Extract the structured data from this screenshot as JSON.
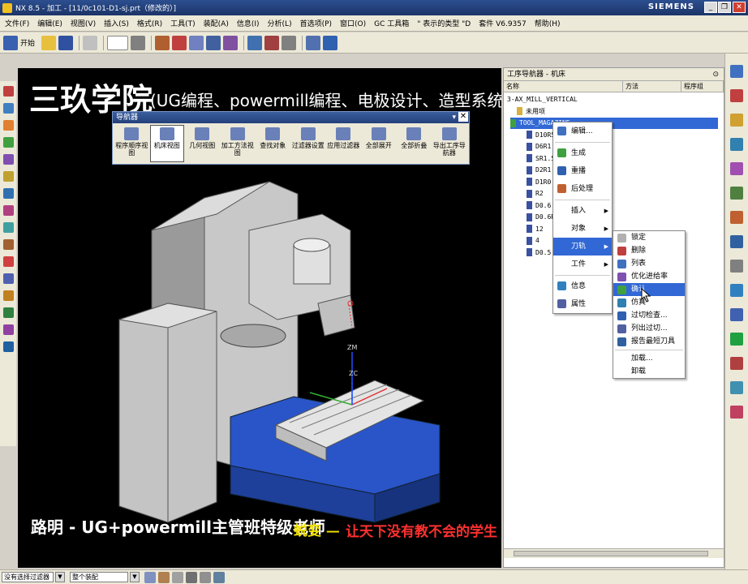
{
  "window": {
    "title": "NX 8.5 - 加工 - [11/0c101-D1-sj.prt（修改的）]",
    "brand": "SIEMENS",
    "minimize": "_",
    "restore": "❐",
    "close": "✕"
  },
  "menubar": {
    "items": [
      "文件(F)",
      "编辑(E)",
      "视图(V)",
      "插入(S)",
      "格式(R)",
      "工具(T)",
      "装配(A)",
      "信息(I)",
      "分析(L)",
      "首选项(P)",
      "窗口(O)",
      "GC 工具箱",
      "\" 表示的类型 \"D",
      "套件 V6.9357",
      "帮助(H)"
    ]
  },
  "toolbar": {
    "start_label": "开始",
    "items": [
      "start-icon",
      "open-icon",
      "save-icon",
      "undo-icon",
      "layer-icon",
      "view-icon",
      "snap-icon",
      "display-icon"
    ]
  },
  "viewport": {
    "title": "三玖学院",
    "subtitle": "(UG编程、powermill编程、电极设计、造型系统化学习)",
    "bottom_left": "路明 - UG+powermill主管班特级老师",
    "bottom_mid": "蜕变 —",
    "bottom_right": "让天下没有教不会的学生",
    "axis_zm": "ZM",
    "axis_zc": "ZC"
  },
  "navigator_popup": {
    "title": "导航器",
    "buttons": [
      {
        "label": "程序顺序视图",
        "active": false
      },
      {
        "label": "机床视图",
        "active": true
      },
      {
        "label": "几何视图",
        "active": false
      },
      {
        "label": "加工方法视图",
        "active": false
      },
      {
        "label": "查找对象",
        "active": false
      },
      {
        "label": "过滤器设置",
        "active": false
      },
      {
        "label": "应用过滤器",
        "active": false
      },
      {
        "label": "全部展开",
        "active": false
      },
      {
        "label": "全部折叠",
        "active": false
      },
      {
        "label": "导出工序导航器",
        "active": false
      }
    ]
  },
  "opnav": {
    "title": "工序导航器 - 机床",
    "col_name": "名称",
    "col_method": "方法",
    "col_program": "程序组",
    "rows": [
      "3-AX_MILL_VERTICAL",
      "未用项",
      "TOOL_MAGAZINE",
      "D10R5",
      "D6R1",
      "SR1.5",
      "D2R1",
      "D1R0.5",
      "R2",
      "D0.6",
      "D0.6R2",
      "12",
      "4",
      "D0.5"
    ]
  },
  "context_menu": {
    "items": [
      {
        "label": "编辑...",
        "has_sub": false,
        "hl": false
      },
      {
        "label": "生成",
        "has_sub": false,
        "hl": false
      },
      {
        "label": "重播",
        "has_sub": false,
        "hl": false
      },
      {
        "label": "后处理",
        "has_sub": false,
        "hl": false
      },
      {
        "label": "插入",
        "has_sub": true,
        "hl": false
      },
      {
        "label": "对象",
        "has_sub": true,
        "hl": false
      },
      {
        "label": "刀轨",
        "has_sub": true,
        "hl": true
      },
      {
        "label": "工件",
        "has_sub": true,
        "hl": false
      },
      {
        "label": "信息",
        "has_sub": false,
        "hl": false
      },
      {
        "label": "属性",
        "has_sub": false,
        "hl": false
      }
    ]
  },
  "sub_menu": {
    "items": [
      {
        "label": "锁定",
        "hl": false
      },
      {
        "label": "删除",
        "hl": false
      },
      {
        "label": "列表",
        "hl": false
      },
      {
        "label": "优化进给率",
        "hl": false
      },
      {
        "label": "确认",
        "hl": true
      },
      {
        "label": "仿真",
        "hl": false
      },
      {
        "label": "过切检查...",
        "hl": false
      },
      {
        "label": "列出过切...",
        "hl": false
      },
      {
        "label": "报告最短刀具",
        "hl": false
      },
      {
        "label": "加载...",
        "hl": false
      },
      {
        "label": "卸载",
        "hl": false
      }
    ]
  },
  "statusbar": {
    "filter": "没有选择过滤器",
    "scope": "整个装配"
  },
  "colors": {
    "accent": "#3168d5",
    "machine_gray": "#b8b8b8",
    "table_blue": "#2a55c8"
  }
}
